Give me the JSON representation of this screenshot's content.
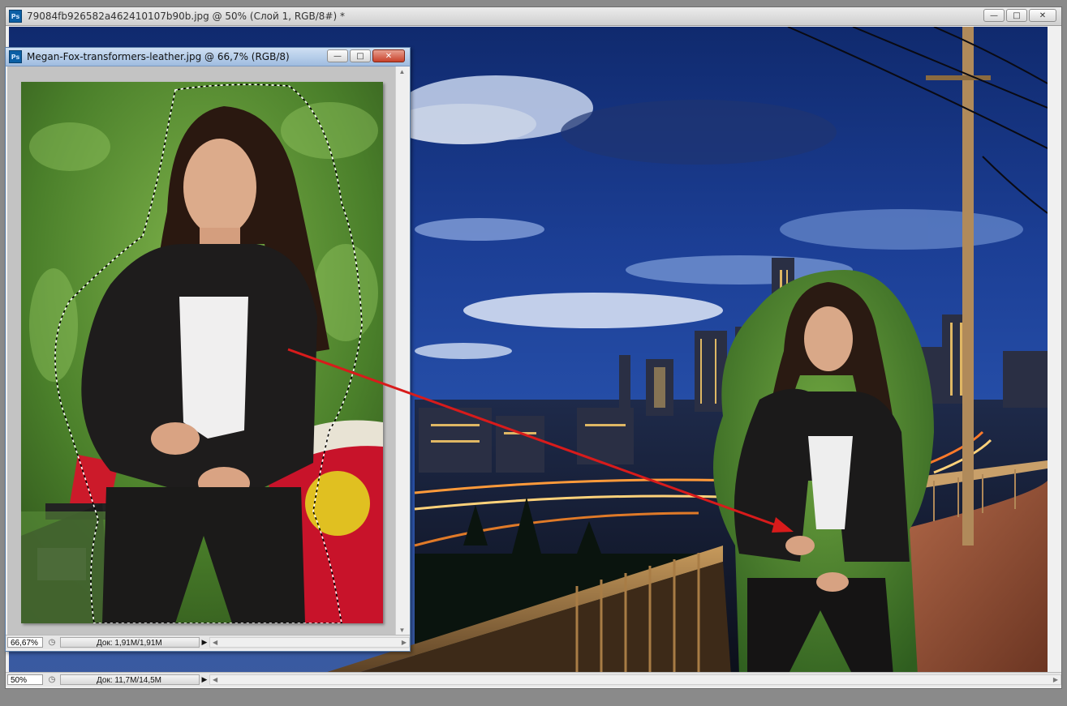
{
  "main_window": {
    "title": "79084fb926582a462410107b90b.jpg @ 50% (Слой 1, RGB/8#) *",
    "app_badge": "Ps",
    "zoom": "50%",
    "doc_info": "Док: 11,7M/14,5M",
    "buttons": {
      "minimize": "—",
      "maximize": "□",
      "close": "✕"
    }
  },
  "sub_window": {
    "title": "Megan-Fox-transformers-leather.jpg @ 66,7% (RGB/8)",
    "app_badge": "Ps",
    "zoom": "66,67%",
    "doc_info": "Док: 1,91M/1,91M",
    "buttons": {
      "minimize": "—",
      "maximize": "□",
      "close": "✕"
    }
  },
  "colors": {
    "accent_arrow": "#d81b1b",
    "sky": "#1e3c8c",
    "titlebar": "#d4d4d4"
  },
  "icons": [
    "photoshop-icon",
    "minimize-icon",
    "maximize-icon",
    "close-icon",
    "clock-icon",
    "arrow-right-icon",
    "chevron-left-icon",
    "chevron-right-icon",
    "chevron-up-icon",
    "chevron-down-icon"
  ]
}
